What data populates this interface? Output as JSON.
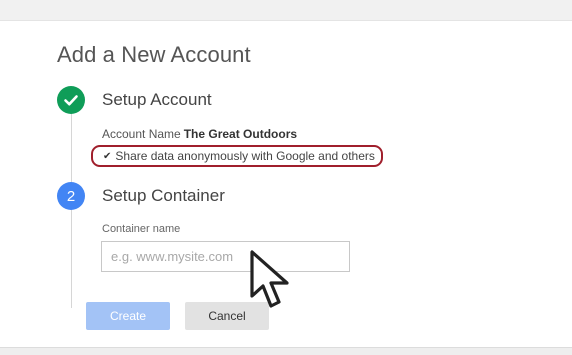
{
  "page": {
    "title": "Add a New Account"
  },
  "steps": [
    {
      "number": "1",
      "title": "Setup Account",
      "status": "complete",
      "account_label": "Account Name",
      "account_value": "The Great Outdoors",
      "share_text": "Share data anonymously with Google and others",
      "share_checked": true
    },
    {
      "number": "2",
      "title": "Setup Container",
      "status": "active",
      "field_label": "Container name",
      "field_placeholder": "e.g. www.mysite.com",
      "field_value": ""
    }
  ],
  "actions": {
    "create_label": "Create",
    "cancel_label": "Cancel"
  },
  "icons": {
    "step1": "checkmark-icon",
    "share_check": "small-checkmark-icon",
    "cursor": "mouse-pointer-icon"
  },
  "colors": {
    "step_complete": "#0f9d58",
    "step_active": "#4285f4",
    "highlight_outline": "#a01f2c",
    "create_button": "#a3c3f6",
    "cancel_button": "#e2e2e2"
  }
}
